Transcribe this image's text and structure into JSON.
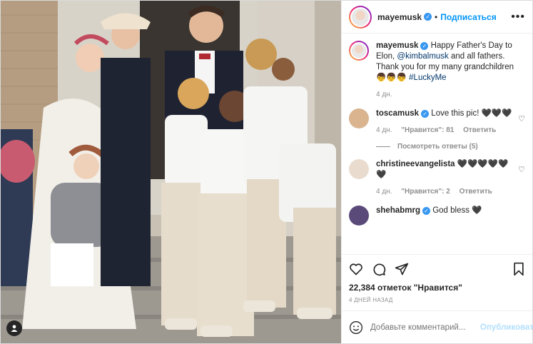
{
  "header": {
    "username": "mayemusk",
    "follow_label": "Подписаться",
    "dot": "•",
    "more": "•••"
  },
  "caption": {
    "username": "mayemusk",
    "text_before": "Happy Father's Day to Elon, ",
    "mention": "@kimbalmusk",
    "text_after": " and all fathers. Thank you for my many grandchildren 👦👦👦 ",
    "hashtag": "#LuckyMe",
    "time": "4 дн."
  },
  "comments": [
    {
      "username": "toscamusk",
      "text": "Love this pic! 🖤🖤🖤",
      "time": "4 дн.",
      "likes": "\"Нравится\": 81",
      "reply": "Ответить",
      "avatar_color": "#d9b48f"
    },
    {
      "username": "christineevangelista",
      "text": "🖤🖤🖤🖤🖤 🖤",
      "time": "4 дн.",
      "likes": "\"Нравится\": 2",
      "reply": "Ответить",
      "avatar_color": "#e9dccf"
    },
    {
      "username": "shehabmrg",
      "text": "God bless 🖤",
      "avatar_color": "#5a4a7a"
    }
  ],
  "view_replies": "Посмотреть ответы (5)",
  "likes_text": "22,384 отметок \"Нравится\"",
  "date_text": "4 ДНЕЙ НАЗАД",
  "add_comment": {
    "placeholder": "Добавьте комментарий...",
    "publish_label": "Опубликовать"
  },
  "colors": {
    "accent": "#0095f6",
    "verified": "#3897f0",
    "muted": "#8e8e8e"
  }
}
